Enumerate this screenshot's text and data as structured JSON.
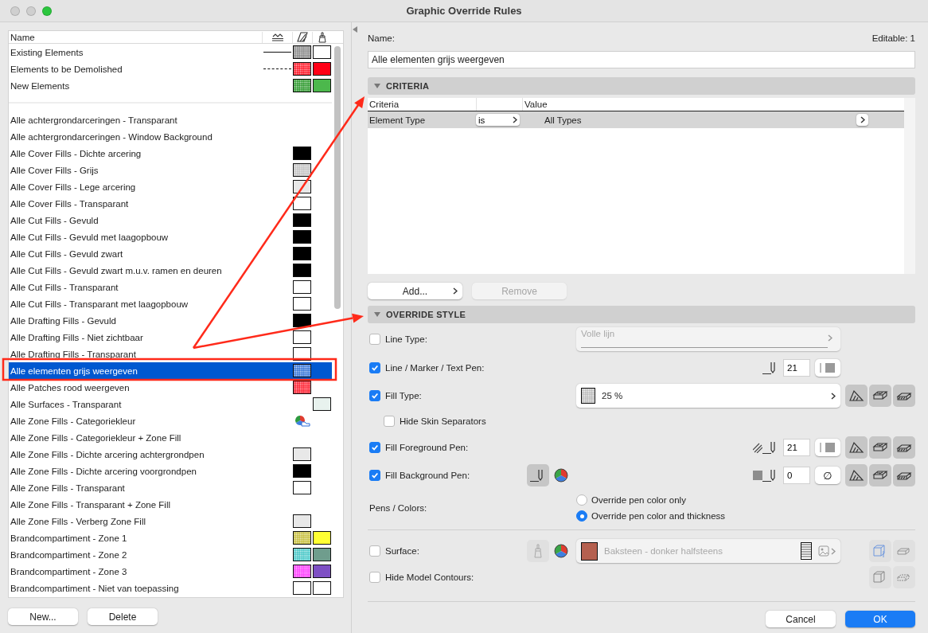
{
  "window": {
    "title": "Graphic Override Rules"
  },
  "rules_list": {
    "header": "Name",
    "groups": [
      {
        "items": [
          {
            "name": "Existing Elements",
            "line": {
              "dashed": false
            },
            "fill": {
              "kind": "dotted",
              "color": "#8a8a8a"
            },
            "surface": {
              "color": "#ffffff"
            },
            "selected": false
          },
          {
            "name": "Elements to be Demolished",
            "line": {
              "dashed": true
            },
            "fill": {
              "kind": "dotted",
              "color": "#ff1a2a"
            },
            "surface": {
              "color": "#ff0016"
            },
            "selected": false
          },
          {
            "name": "New Elements",
            "fill": {
              "kind": "dotted",
              "color": "#2f9a2f"
            },
            "surface": {
              "color": "#4cb84c"
            },
            "selected": false
          }
        ]
      },
      {
        "items": [
          {
            "name": "Alle achtergrondarceringen - Transparant",
            "selected": false
          },
          {
            "name": "Alle achtergrondarceringen - Window Background",
            "selected": false
          },
          {
            "name": "Alle Cover Fills - Dichte arcering",
            "fill": {
              "kind": "solid",
              "color": "#000000"
            },
            "selected": false
          },
          {
            "name": "Alle Cover Fills - Grijs",
            "fill": {
              "kind": "dotted",
              "color": "#c4c4c4"
            },
            "selected": false
          },
          {
            "name": "Alle Cover Fills - Lege arcering",
            "fill": {
              "kind": "solid",
              "color": "#e8e8e8"
            },
            "selected": false
          },
          {
            "name": "Alle Cover Fills - Transparant",
            "fill": {
              "kind": "solid",
              "color": "#ffffff"
            },
            "selected": false
          },
          {
            "name": "Alle Cut Fills - Gevuld",
            "fill": {
              "kind": "solid",
              "color": "#000000"
            },
            "selected": false
          },
          {
            "name": "Alle Cut Fills - Gevuld met laagopbouw",
            "fill": {
              "kind": "solid",
              "color": "#000000"
            },
            "selected": false
          },
          {
            "name": "Alle Cut Fills - Gevuld zwart",
            "fill": {
              "kind": "solid",
              "color": "#000000"
            },
            "selected": false
          },
          {
            "name": "Alle Cut Fills - Gevuld zwart m.u.v. ramen en deuren",
            "fill": {
              "kind": "solid",
              "color": "#000000"
            },
            "selected": false
          },
          {
            "name": "Alle Cut Fills - Transparant",
            "fill": {
              "kind": "solid",
              "color": "#ffffff"
            },
            "selected": false
          },
          {
            "name": "Alle Cut Fills - Transparant met laagopbouw",
            "fill": {
              "kind": "solid",
              "color": "#ffffff"
            },
            "selected": false
          },
          {
            "name": "Alle Drafting Fills - Gevuld",
            "fill": {
              "kind": "solid",
              "color": "#000000"
            },
            "selected": false
          },
          {
            "name": "Alle Drafting Fills - Niet zichtbaar",
            "fill": {
              "kind": "solid",
              "color": "#ffffff"
            },
            "selected": false
          },
          {
            "name": "Alle Drafting Fills - Transparant",
            "fill": {
              "kind": "solid",
              "color": "#ffffff"
            },
            "selected": false
          },
          {
            "name": "Alle elementen grijs weergeven",
            "fill": {
              "kind": "dotted",
              "color": "#3a78d8"
            },
            "selected": true
          },
          {
            "name": "Alle Patches rood weergeven",
            "fill": {
              "kind": "dotted",
              "color": "#ff2030"
            },
            "selected": false
          },
          {
            "name": "Alle Surfaces - Transparant",
            "surface": {
              "color": "#e8f2ee"
            },
            "selected": false
          },
          {
            "name": "Alle Zone Fills - Categoriekleur",
            "fill": {
              "kind": "category"
            },
            "selected": false
          },
          {
            "name": "Alle Zone Fills - Categoriekleur + Zone Fill",
            "selected": false
          },
          {
            "name": "Alle Zone Fills - Dichte arcering achtergrondpen",
            "fill": {
              "kind": "solid",
              "color": "#e8e8e8"
            },
            "selected": false
          },
          {
            "name": "Alle Zone Fills - Dichte arcering voorgrondpen",
            "fill": {
              "kind": "solid",
              "color": "#000000"
            },
            "selected": false
          },
          {
            "name": "Alle Zone Fills - Transparant",
            "fill": {
              "kind": "solid",
              "color": "#ffffff"
            },
            "selected": false
          },
          {
            "name": "Alle Zone Fills - Transparant + Zone Fill",
            "selected": false
          },
          {
            "name": "Alle Zone Fills - Verberg Zone Fill",
            "fill": {
              "kind": "solid",
              "color": "#e8e8e8"
            },
            "selected": false
          },
          {
            "name": "Brandcompartiment -  Zone 1",
            "fill": {
              "kind": "dotted",
              "color": "#c8c040"
            },
            "surface": {
              "color": "#ffff33"
            },
            "selected": false
          },
          {
            "name": "Brandcompartiment -  Zone 2",
            "fill": {
              "kind": "dotted",
              "color": "#4ac8c8"
            },
            "surface": {
              "color": "#6f9d8d"
            },
            "selected": false
          },
          {
            "name": "Brandcompartiment -  Zone 3",
            "fill": {
              "kind": "dotted",
              "color": "#ff3cff"
            },
            "surface": {
              "color": "#7e4fc4"
            },
            "selected": false
          },
          {
            "name": "Brandcompartiment - Niet van toepassing",
            "fill": {
              "kind": "solid",
              "color": "#ffffff"
            },
            "surface": {
              "color": "#ffffff"
            },
            "selected": false
          }
        ]
      }
    ]
  },
  "list_buttons": [
    "New...",
    "Delete"
  ],
  "editor": {
    "name_label": "Name:",
    "editable": "Editable: 1",
    "name_value": "Alle elementen grijs weergeven",
    "criteria": {
      "title": "CRITERIA",
      "expanded": true,
      "columns": [
        "Criteria",
        "Value"
      ],
      "rows": [
        {
          "criterion": "Element Type",
          "operator": "is",
          "value": "All Types",
          "selected": true
        }
      ],
      "buttons": [
        {
          "label": "Add...",
          "disabled": false,
          "menu": true
        },
        {
          "label": "Remove",
          "disabled": true,
          "menu": false
        }
      ]
    },
    "override_style": {
      "title": "OVERRIDE STYLE",
      "expanded": true,
      "rows": [
        {
          "kind": "line_type",
          "label": "Line Type:",
          "checked": false,
          "value": "Volle lijn",
          "disabled": true
        },
        {
          "kind": "pen",
          "label": "Line / Marker / Text Pen:",
          "checked": true,
          "pen": "21",
          "hatched": false,
          "scope": false
        },
        {
          "kind": "fill_type",
          "label": "Fill Type:",
          "checked": true,
          "value": "25 %"
        },
        {
          "kind": "suboption",
          "label": "Hide Skin Separators",
          "checked": false
        },
        {
          "kind": "pen",
          "label": "Fill Foreground Pen:",
          "checked": true,
          "pen": "21",
          "hatched": true,
          "scope": true
        },
        {
          "kind": "bg_pen",
          "label": "Fill Background Pen:",
          "checked": true,
          "pen": "0",
          "clear": "∅"
        },
        {
          "kind": "radios",
          "label": "Pens / Colors:",
          "options": [
            {
              "label": "Override pen color only",
              "selected": false
            },
            {
              "label": "Override pen color and thickness",
              "selected": true
            }
          ]
        }
      ]
    },
    "model_rows": [
      {
        "kind": "surface",
        "label": "Surface:",
        "checked": false,
        "value": "Baksteen - donker halfsteens",
        "color": "#b5604f",
        "disabled": true
      },
      {
        "kind": "contours",
        "label": "Hide Model Contours:",
        "checked": false
      }
    ],
    "footer_buttons": [
      {
        "label": "Cancel",
        "default": false
      },
      {
        "label": "OK",
        "default": true
      }
    ]
  }
}
